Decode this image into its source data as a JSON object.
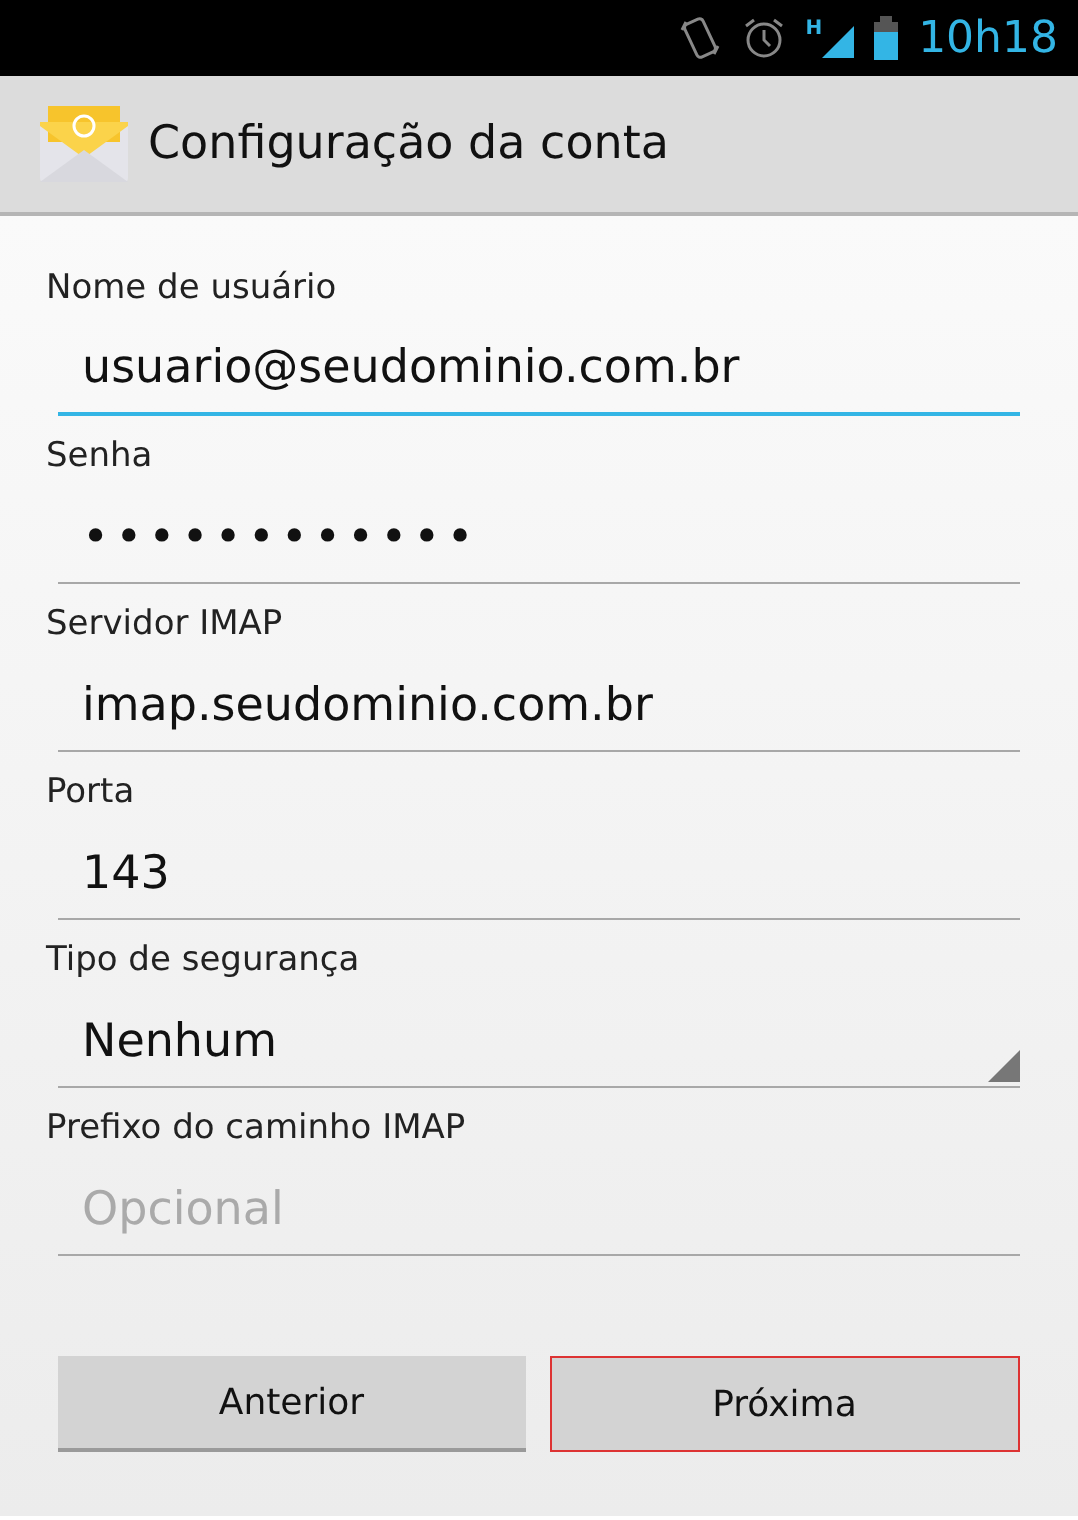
{
  "status_bar": {
    "time": "10h18",
    "network": "H"
  },
  "header": {
    "title": "Configuração da conta"
  },
  "fields": [
    {
      "label": "Nome de usuário",
      "kind": "text",
      "value": "usuario@seudominio.com.br",
      "focused": true
    },
    {
      "label": "Senha",
      "kind": "password",
      "value": "••••••••••••",
      "focused": false
    },
    {
      "label": "Servidor IMAP",
      "kind": "text",
      "value": "imap.seudominio.com.br",
      "focused": false
    },
    {
      "label": "Porta",
      "kind": "text",
      "value": "143",
      "focused": false
    },
    {
      "label": "Tipo de segurança",
      "kind": "dropdown",
      "value": "Nenhum",
      "focused": false
    },
    {
      "label": "Prefixo do caminho IMAP",
      "kind": "text",
      "placeholder": "Opcional",
      "focused": false
    }
  ],
  "buttons": [
    {
      "label": "Anterior",
      "highlighted": false
    },
    {
      "label": "Próxima",
      "highlighted": true
    }
  ]
}
